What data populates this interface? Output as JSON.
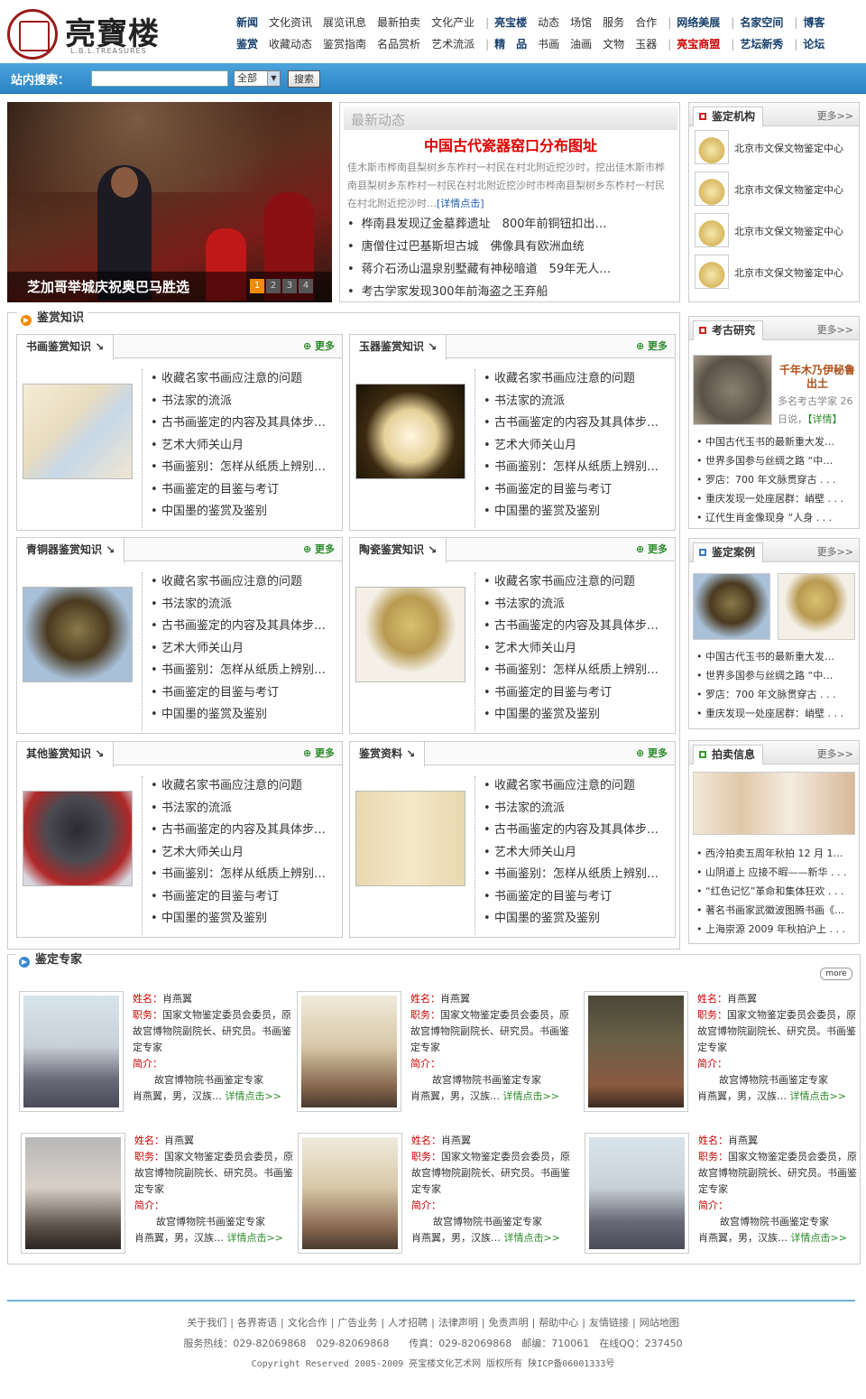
{
  "header": {
    "logo_text": "亮寶楼",
    "logo_sub": "L.B.L.TREASURES",
    "nav_row1": [
      "新闻",
      "文化资讯",
      "展览讯息",
      "最新拍卖",
      "文化产业",
      "亮宝楼",
      "动态",
      "场馆",
      "服务",
      "合作",
      "网络美展",
      "名家空间",
      "博客"
    ],
    "nav_row2": [
      "鉴赏",
      "收藏动态",
      "鉴赏指南",
      "名品赏析",
      "艺术流派",
      "精　品",
      "书画",
      "油画",
      "文物",
      "玉器",
      "亮宝商盟",
      "艺坛新秀",
      "论坛"
    ]
  },
  "search": {
    "label": "站内搜索：",
    "value": "",
    "select": "全部",
    "button": "搜索"
  },
  "hero": {
    "caption": "芝加哥举城庆祝奥巴马胜选",
    "pages": [
      "1",
      "2",
      "3",
      "4"
    ]
  },
  "news": {
    "heading": "最新动态",
    "title": "中国古代瓷器窑口分布图址",
    "summary": "佳木斯市桦南县梨树乡东柞村一村民在村北附近挖沙时，挖出佳木斯市桦南县梨树乡东柞村一村民在村北附近挖沙时市桦南县梨树乡东柞村一村民在村北附近挖沙时…",
    "detail": "[详情点击]",
    "items": [
      "桦南县发现辽金墓葬遗址　800年前铜钮扣出…",
      "唐僧住过巴基斯坦古城　佛像具有欧洲血统",
      "蒋介石汤山温泉别墅藏有神秘暗道　59年无人…",
      "考古学家发现300年前海盗之王弃船"
    ]
  },
  "orgs": {
    "title": "鉴定机构",
    "more": "更多>>",
    "items": [
      "北京市文保文物鉴定中心",
      "北京市文保文物鉴定中心",
      "北京市文保文物鉴定中心",
      "北京市文保文物鉴定中心"
    ]
  },
  "archaeo": {
    "title": "考古研究",
    "more": "更多>>",
    "feature_title": "千年木乃伊秘鲁出土",
    "feature_text": "多名考古学家 26 日说，",
    "feature_link": "【详情】",
    "items": [
      "中国古代玉书的最新重大发…",
      "世界多国参与丝绸之路 “中…",
      "罗店：700 年文脉贯穿古 . . .",
      "重庆发现一处座居群：峭壁 . . .",
      "辽代生肖金像现身 “人身 . . ."
    ]
  },
  "cases": {
    "title": "鉴定案例",
    "more": "更多>>",
    "items": [
      "中国古代玉书的最新重大发…",
      "世界多国参与丝绸之路 “中…",
      "罗店：700 年文脉贯穿古 . . .",
      "重庆发现一处座居群：峭壁 . . ."
    ]
  },
  "auction": {
    "title": "拍卖信息",
    "more": "更多>>",
    "items": [
      "西泠拍卖五周年秋拍 12 月 1…",
      "山阴道上 应接不暇——新华 . . .",
      "“红色记忆”革命和集体狂欢 . . .",
      "著名书画家武徽波图腾书画《…",
      "上海崇源 2009 年秋拍沪上 . . ."
    ]
  },
  "knowledge": {
    "title": "鉴赏知识",
    "more": "更多",
    "boxes": [
      {
        "title": "书画鉴赏知识",
        "items": [
          "收藏名家书画应注意的问题",
          "书法家的流派",
          "古书画鉴定的内容及其具体步…",
          "艺术大师关山月",
          "书画鉴别：怎样从纸质上辨别…",
          "书画鉴定的目鉴与考订",
          "中国墨的鉴赏及鉴别"
        ]
      },
      {
        "title": "玉器鉴赏知识",
        "items": [
          "收藏名家书画应注意的问题",
          "书法家的流派",
          "古书画鉴定的内容及其具体步…",
          "艺术大师关山月",
          "书画鉴别：怎样从纸质上辨别…",
          "书画鉴定的目鉴与考订",
          "中国墨的鉴赏及鉴别"
        ]
      },
      {
        "title": "青铜器鉴赏知识",
        "items": [
          "收藏名家书画应注意的问题",
          "书法家的流派",
          "古书画鉴定的内容及其具体步…",
          "艺术大师关山月",
          "书画鉴别：怎样从纸质上辨别…",
          "书画鉴定的目鉴与考订",
          "中国墨的鉴赏及鉴别"
        ]
      },
      {
        "title": "陶瓷鉴赏知识",
        "items": [
          "收藏名家书画应注意的问题",
          "书法家的流派",
          "古书画鉴定的内容及其具体步…",
          "艺术大师关山月",
          "书画鉴别：怎样从纸质上辨别…",
          "书画鉴定的目鉴与考订",
          "中国墨的鉴赏及鉴别"
        ]
      },
      {
        "title": "其他鉴赏知识",
        "items": [
          "收藏名家书画应注意的问题",
          "书法家的流派",
          "古书画鉴定的内容及其具体步…",
          "艺术大师关山月",
          "书画鉴别：怎样从纸质上辨别…",
          "书画鉴定的目鉴与考订",
          "中国墨的鉴赏及鉴别"
        ]
      },
      {
        "title": "鉴赏资料",
        "items": [
          "收藏名家书画应注意的问题",
          "书法家的流派",
          "古书画鉴定的内容及其具体步…",
          "艺术大师关山月",
          "书画鉴别：怎样从纸质上辨别…",
          "书画鉴定的目鉴与考订",
          "中国墨的鉴赏及鉴别"
        ]
      }
    ]
  },
  "experts": {
    "title": "鉴定专家",
    "more": "more",
    "card": {
      "name_label": "姓名：",
      "name": "肖燕翼",
      "duty_label": "职务：",
      "duty": "国家文物鉴定委员会委员，原故宫博物院副院长、研究员。书画鉴定专家",
      "intro_label": "简介：",
      "intro": "故宫博物院书画鉴定专家",
      "intro2": "肖燕翼，男，汉族…",
      "link": "详情点击>>"
    }
  },
  "footer": {
    "links": [
      "关于我们",
      "各界寄语",
      "文化合作",
      "广告业务",
      "人才招聘",
      "法律声明",
      "免责声明",
      "帮助中心",
      "友情链接",
      "网站地图"
    ],
    "contact": "服务热线：029-82069868　029-82069868　　传真：029-82069868　邮编：710061　在线QQ：237450",
    "copyright": "Copyright Reserved 2005-2009 亮宝楼文化艺术网 版权所有 陕ICP备06001333号"
  }
}
